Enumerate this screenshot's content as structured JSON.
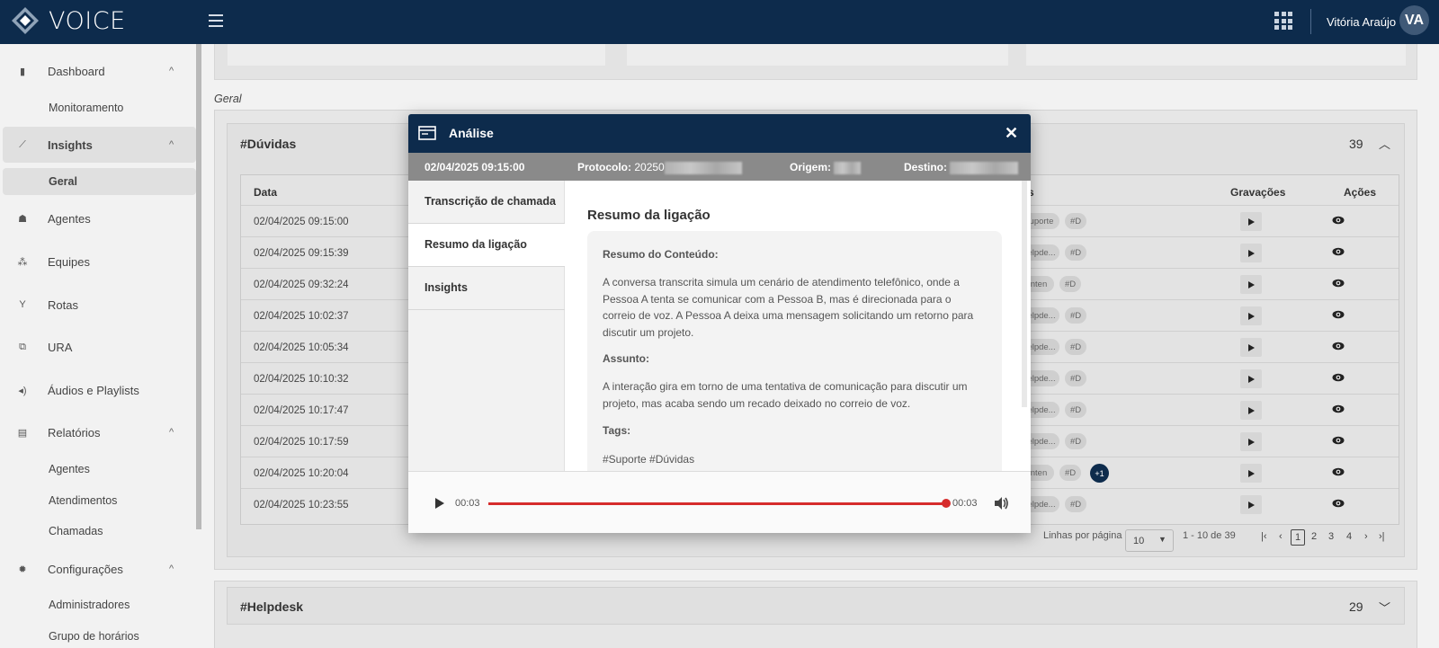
{
  "app": {
    "logo_text": "VOICE",
    "user_name": "Vitória Araújo",
    "user_initials": "VA"
  },
  "sidebar": {
    "items": [
      {
        "label": "Dashboard",
        "icon": "bar-chart-icon"
      },
      {
        "label": "Monitoramento"
      },
      {
        "label": "Insights",
        "icon": "trend-icon"
      },
      {
        "label": "Geral"
      },
      {
        "label": "Agentes",
        "icon": "headset-icon"
      },
      {
        "label": "Equipes",
        "icon": "group-icon"
      },
      {
        "label": "Rotas",
        "icon": "route-icon"
      },
      {
        "label": "URA",
        "icon": "hierarchy-icon"
      },
      {
        "label": "Áudios e Playlists",
        "icon": "speaker-icon"
      },
      {
        "label": "Relatórios",
        "icon": "book-icon"
      },
      {
        "label": "Agentes"
      },
      {
        "label": "Atendimentos"
      },
      {
        "label": "Chamadas"
      },
      {
        "label": "Configurações",
        "icon": "gear-icon"
      },
      {
        "label": "Administradores"
      },
      {
        "label": "Grupo de horários"
      }
    ]
  },
  "main": {
    "section_label": "Geral",
    "panel_duvidas": {
      "title": "#Dúvidas",
      "count": "39"
    },
    "panel_helpdesk": {
      "title": "#Helpdesk",
      "count": "29"
    },
    "table": {
      "headers": {
        "data": "Data",
        "tags": "s",
        "gravacoes": "Gravações",
        "acoes": "Ações"
      },
      "rows": [
        {
          "date": "02/04/2025 09:15:00",
          "tag1": "uporte",
          "tag2": "#D"
        },
        {
          "date": "02/04/2025 09:15:39",
          "tag1": "elpde...",
          "tag2": "#D"
        },
        {
          "date": "02/04/2025 09:32:24",
          "tag1": "nten",
          "tag2": "#D"
        },
        {
          "date": "02/04/2025 10:02:37",
          "tag1": "elpde...",
          "tag2": "#D"
        },
        {
          "date": "02/04/2025 10:05:34",
          "tag1": "elpde...",
          "tag2": "#D"
        },
        {
          "date": "02/04/2025 10:10:32",
          "tag1": "elpde...",
          "tag2": "#D"
        },
        {
          "date": "02/04/2025 10:17:47",
          "tag1": "elpde...",
          "tag2": "#D"
        },
        {
          "date": "02/04/2025 10:17:59",
          "tag1": "elpde...",
          "tag2": "#D"
        },
        {
          "date": "02/04/2025 10:20:04",
          "tag1": "nten",
          "tag2": "#D",
          "extra": "+1"
        },
        {
          "date": "02/04/2025 10:23:55",
          "tag1": "elpde...",
          "tag2": "#D"
        }
      ]
    },
    "pagination": {
      "rows_label": "Linhas por página",
      "rows_value": "10",
      "range": "1 - 10 de 39",
      "pages": [
        "1",
        "2",
        "3",
        "4"
      ]
    }
  },
  "modal": {
    "title": "Análise",
    "info": {
      "datetime": "02/04/2025 09:15:00",
      "protocol_label": "Protocolo:",
      "protocol_value": "20250",
      "origin_label": "Origem:",
      "dest_label": "Destino:"
    },
    "tabs": [
      "Transcrição de chamada",
      "Resumo da ligação",
      "Insights"
    ],
    "content": {
      "heading": "Resumo da ligação",
      "h_resumo": "Resumo do Conteúdo:",
      "p_resumo": "A conversa transcrita simula um cenário de atendimento telefônico, onde a Pessoa A tenta se comunicar com a Pessoa B, mas é direcionada para o correio de voz. A Pessoa A deixa uma mensagem solicitando um retorno para discutir um projeto.",
      "h_assunto": "Assunto:",
      "p_assunto": "A interação gira em torno de uma tentativa de comunicação para discutir um projeto, mas acaba sendo um recado deixado no correio de voz.",
      "h_tags": "Tags:",
      "p_tags": "#Suporte #Dúvidas"
    },
    "player": {
      "current": "00:03",
      "total": "00:03",
      "progress": 1.0,
      "accent": "#d62b2b"
    }
  },
  "colors": {
    "brand": "#0d2b4c",
    "accent": "#d62b2b"
  }
}
